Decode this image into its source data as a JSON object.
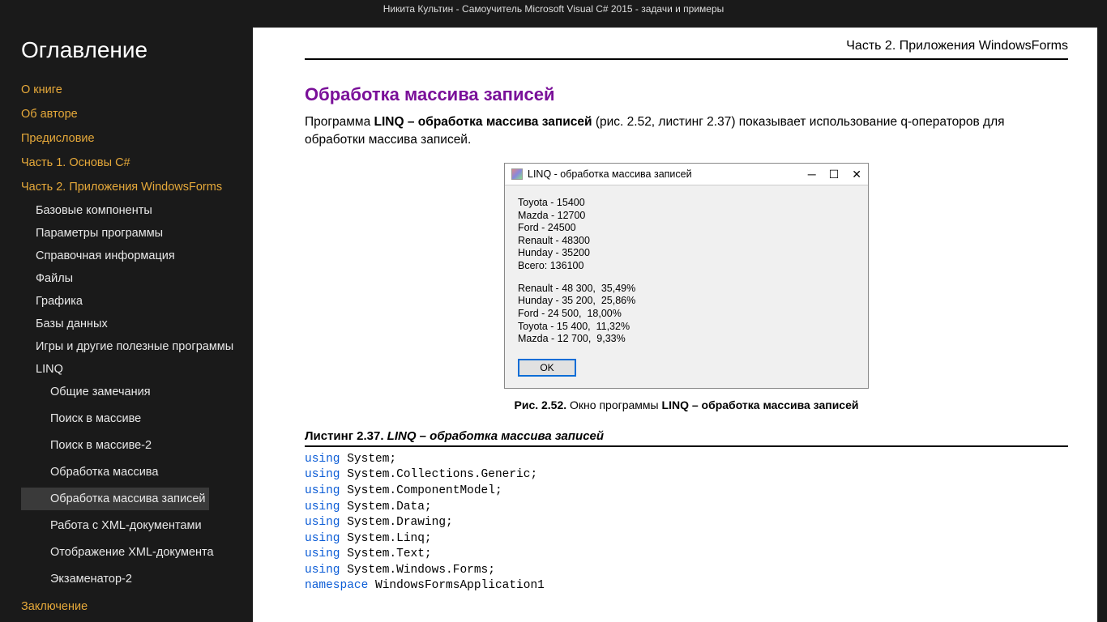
{
  "top_title": "Никита Культин - Самоучитель Microsoft Visual C# 2015 - задачи и примеры",
  "sidebar": {
    "title": "Оглавление",
    "items": [
      {
        "label": "О книге",
        "level": 1
      },
      {
        "label": "Об авторе",
        "level": 1
      },
      {
        "label": "Предисловие",
        "level": 1
      },
      {
        "label": "Часть 1. Основы C#",
        "level": 1
      },
      {
        "label": "Часть 2. Приложения WindowsForms",
        "level": 1
      },
      {
        "label": "Базовые компоненты",
        "level": 2
      },
      {
        "label": "Параметры программы",
        "level": 2
      },
      {
        "label": "Справочная информация",
        "level": 2
      },
      {
        "label": "Файлы",
        "level": 2
      },
      {
        "label": "Графика",
        "level": 2
      },
      {
        "label": "Базы данных",
        "level": 2
      },
      {
        "label": "Игры и другие полезные программы",
        "level": 2
      },
      {
        "label": "LINQ",
        "level": 2
      },
      {
        "label": "Общие замечания",
        "level": 3
      },
      {
        "label": "Поиск в массиве",
        "level": 3
      },
      {
        "label": "Поиск в массиве-2",
        "level": 3
      },
      {
        "label": "Обработка массива",
        "level": 3
      },
      {
        "label": "Обработка массива записей",
        "level": 3,
        "selected": true
      },
      {
        "label": "Работа с XML-документами",
        "level": 3
      },
      {
        "label": "Отображение XML-документа",
        "level": 3
      },
      {
        "label": "Экзаменатор-2",
        "level": 3
      },
      {
        "label": "Заключение",
        "level": 1
      }
    ]
  },
  "page": {
    "header": "Часть 2. Приложения WindowsForms",
    "title": "Обработка массива записей",
    "para_prefix": "Программа ",
    "para_bold": "LINQ – обработка массива записей",
    "para_suffix": " (рис. 2.52, листинг 2.37) показывает использование q-операторов для обработки массива записей.",
    "figure": {
      "window_title": "LINQ - обработка массива записей",
      "block1": "Toyota - 15400\nMazda - 12700\nFord - 24500\nRenault - 48300\nHunday - 35200\nВсего: 136100",
      "block2": "Renault - 48 300,  35,49%\nHunday - 35 200,  25,86%\nFord - 24 500,  18,00%\nToyota - 15 400,  11,32%\nMazda - 12 700,  9,33%",
      "ok": "OK",
      "caption_b": "Рис. 2.52.",
      "caption_rest_pre": " Окно программы ",
      "caption_rest_b": "LINQ – обработка массива записей"
    },
    "listing_num": "Листинг 2.37. ",
    "listing_title": "LINQ – обработка массива записей",
    "code_lines": [
      [
        "using",
        " System;"
      ],
      [
        "using",
        " System.Collections.Generic;"
      ],
      [
        "using",
        " System.ComponentModel;"
      ],
      [
        "using",
        " System.Data;"
      ],
      [
        "using",
        " System.Drawing;"
      ],
      [
        "using",
        " System.Linq;"
      ],
      [
        "using",
        " System.Text;"
      ],
      [
        "using",
        " System.Windows.Forms;"
      ],
      [
        "",
        ""
      ],
      [
        "namespace",
        " WindowsFormsApplication1"
      ]
    ]
  }
}
